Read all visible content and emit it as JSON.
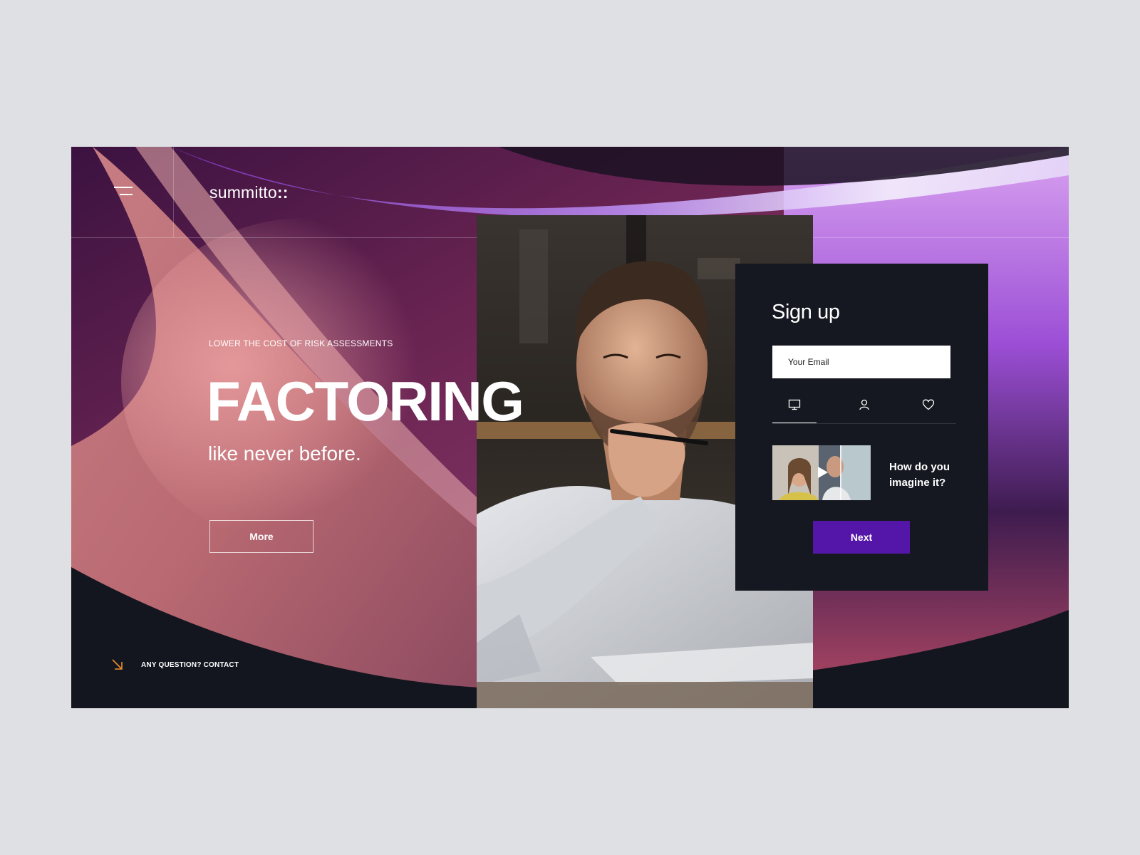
{
  "brand": {
    "name": "summitto",
    "suffix": "::"
  },
  "hero": {
    "eyebrow": "LOWER THE COST OF RISK ASSESSMENTS",
    "headline": "FACTORING",
    "subline": "like never before.",
    "more_label": "More"
  },
  "footer": {
    "contact_label": "ANY QUESTION? CONTACT"
  },
  "signup": {
    "title": "Sign up",
    "email_placeholder": "Your Email",
    "tabs": [
      {
        "icon": "monitor-icon",
        "active": true
      },
      {
        "icon": "user-icon",
        "active": false
      },
      {
        "icon": "heart-icon",
        "active": false
      }
    ],
    "video_caption": "How do you imagine it?",
    "next_label": "Next"
  },
  "colors": {
    "page_bg": "#dfe0e3",
    "dark": "#151820",
    "accent_purple": "#5416a8",
    "contact_arrow": "#e8902e"
  }
}
